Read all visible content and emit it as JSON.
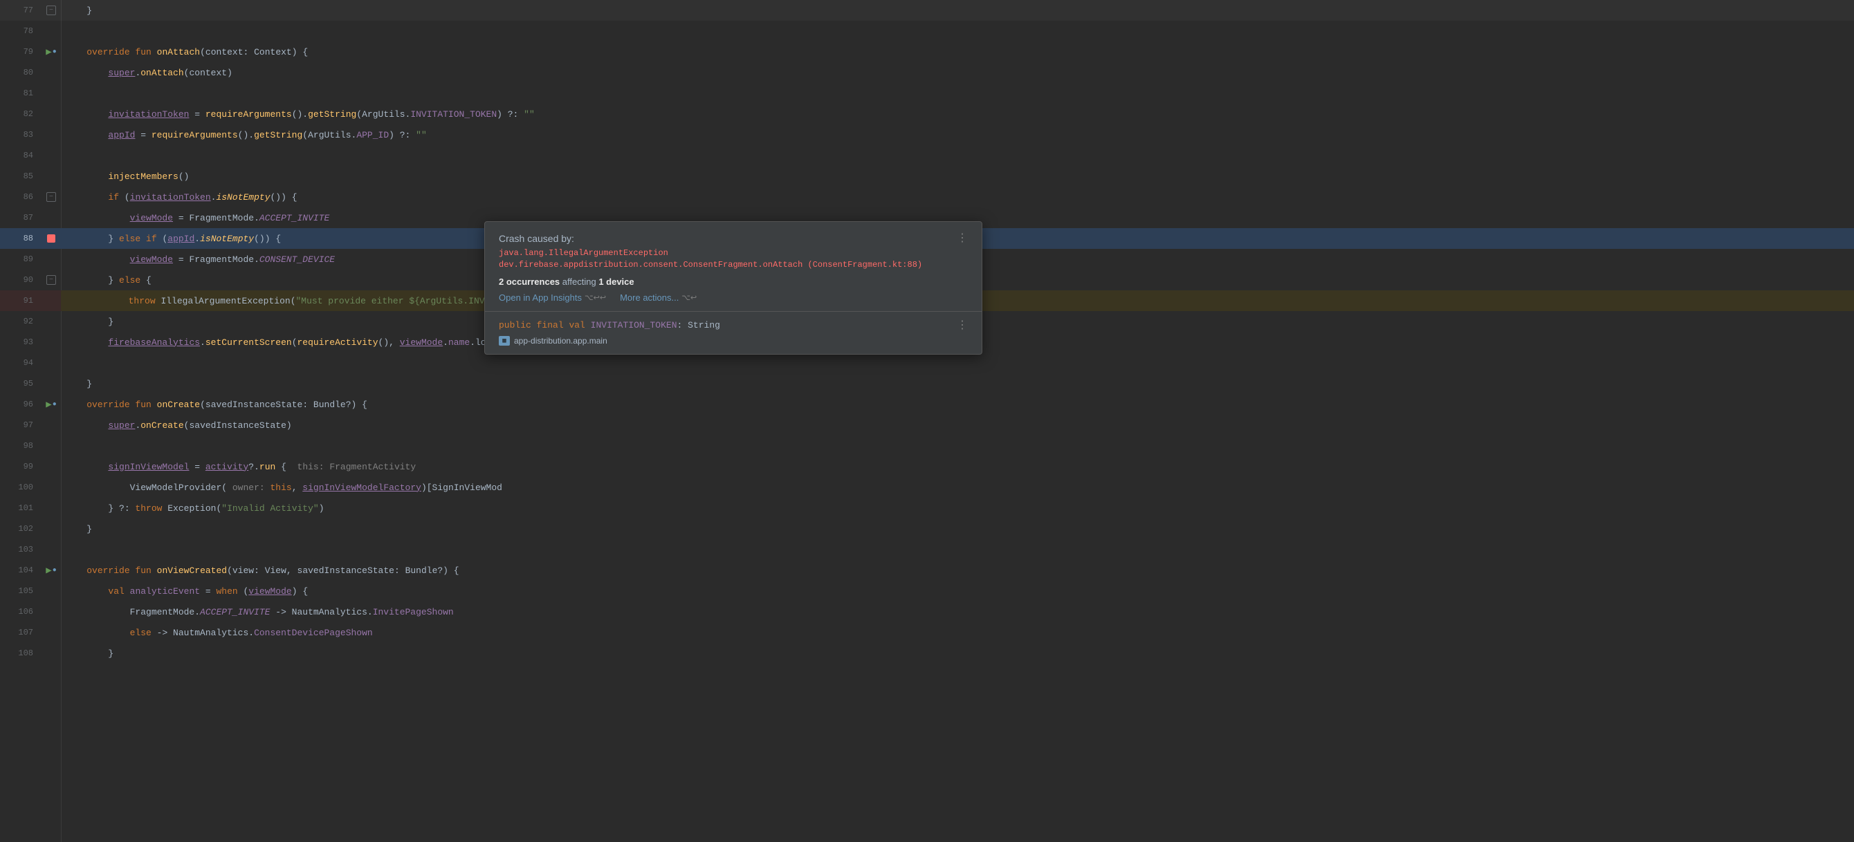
{
  "editor": {
    "lines": [
      {
        "num": 77,
        "gutter": "fold-close",
        "content": "    }",
        "style": "plain",
        "bg": ""
      },
      {
        "num": 78,
        "gutter": "",
        "content": "",
        "bg": ""
      },
      {
        "num": 79,
        "gutter": "run",
        "content": "    override fun onAttach(context: Context) {",
        "bg": ""
      },
      {
        "num": 80,
        "gutter": "",
        "content": "        super.onAttach(context)",
        "bg": ""
      },
      {
        "num": 81,
        "gutter": "",
        "content": "",
        "bg": ""
      },
      {
        "num": 82,
        "gutter": "",
        "content": "        invitationToken = requireArguments().getString(ArgUtils.INVITATION_TOKEN) ?: \"\"",
        "bg": ""
      },
      {
        "num": 83,
        "gutter": "",
        "content": "        appId = requireArguments().getString(ArgUtils.APP_ID) ?: \"\"",
        "bg": ""
      },
      {
        "num": 84,
        "gutter": "",
        "content": "",
        "bg": ""
      },
      {
        "num": 85,
        "gutter": "",
        "content": "        injectMembers()",
        "bg": ""
      },
      {
        "num": 86,
        "gutter": "fold-open",
        "content": "        if (invitationToken.isNotEmpty()) {",
        "bg": ""
      },
      {
        "num": 87,
        "gutter": "",
        "content": "            viewMode = FragmentMode.ACCEPT_INVITE",
        "bg": ""
      },
      {
        "num": 88,
        "gutter": "breakpoint",
        "content": "        } else if (appId.isNotEmpty()) {",
        "bg": "breakpoint"
      },
      {
        "num": 89,
        "gutter": "",
        "content": "            viewMode = FragmentMode.CONSENT_DEVICE",
        "bg": ""
      },
      {
        "num": 90,
        "gutter": "fold-open",
        "content": "        } else {",
        "bg": ""
      },
      {
        "num": 91,
        "gutter": "",
        "content": "            throw IllegalArgumentException(\"Must provide either ${ArgUtils.INVITATION_TOKEN} or ${ArgUtils.APP_ID} argument\")",
        "bg": "error"
      },
      {
        "num": 92,
        "gutter": "",
        "content": "        }",
        "bg": ""
      },
      {
        "num": 93,
        "gutter": "",
        "content": "        firebaseAnalytics.setCurrentScreen(requireActivity(), viewMode.name.lowe",
        "bg": ""
      },
      {
        "num": 94,
        "gutter": "",
        "content": "",
        "bg": ""
      },
      {
        "num": 95,
        "gutter": "",
        "content": "    }",
        "bg": ""
      },
      {
        "num": 96,
        "gutter": "run",
        "content": "    override fun onCreate(savedInstanceState: Bundle?) {",
        "bg": ""
      },
      {
        "num": 97,
        "gutter": "",
        "content": "        super.onCreate(savedInstanceState)",
        "bg": ""
      },
      {
        "num": 98,
        "gutter": "",
        "content": "",
        "bg": ""
      },
      {
        "num": 99,
        "gutter": "",
        "content": "        signInViewModel = activity?.run {  this: FragmentActivity",
        "bg": ""
      },
      {
        "num": 100,
        "gutter": "",
        "content": "            ViewModelProvider( owner: this, signInViewModelFactory)[SignInViewModel",
        "bg": ""
      },
      {
        "num": 101,
        "gutter": "",
        "content": "        } ?: throw Exception(\"Invalid Activity\")",
        "bg": ""
      },
      {
        "num": 102,
        "gutter": "",
        "content": "    }",
        "bg": ""
      },
      {
        "num": 103,
        "gutter": "",
        "content": "",
        "bg": ""
      },
      {
        "num": 104,
        "gutter": "run",
        "content": "    override fun onViewCreated(view: View, savedInstanceState: Bundle?) {",
        "bg": ""
      },
      {
        "num": 105,
        "gutter": "",
        "content": "        val analyticEvent = when (viewMode) {",
        "bg": ""
      },
      {
        "num": 106,
        "gutter": "",
        "content": "            FragmentMode.ACCEPT_INVITE -> NautmAnalytics.InvitePageShown",
        "bg": ""
      },
      {
        "num": 107,
        "gutter": "",
        "content": "            else -> NautmAnalytics.ConsentDevicePageShown",
        "bg": ""
      },
      {
        "num": 108,
        "gutter": "",
        "content": "        }",
        "bg": ""
      }
    ]
  },
  "popup": {
    "title": "Crash caused by:",
    "error_line1": "java.lang.IllegalArgumentException",
    "error_line2": "dev.firebase.appdistribution.consent.ConsentFragment.onAttach (ConsentFragment.kt:88)",
    "occurrences_text": "2 occurrences affecting 1 device",
    "open_in_app_insights": "Open in App Insights",
    "open_in_app_insights_shortcut": "⌥↩↩",
    "more_actions": "More actions...",
    "more_actions_shortcut": "⌥↩",
    "code_line": "public final val INVITATION_TOKEN: String",
    "module_name": "app-distribution.app.main",
    "three_dots_top": "⋮",
    "three_dots_bottom": "⋮"
  }
}
